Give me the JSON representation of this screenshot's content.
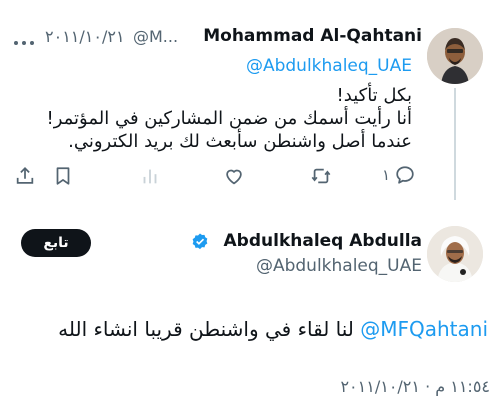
{
  "tweet1": {
    "author_name": "Mohammad Al-Qahtani",
    "handle_trunc": "@M...",
    "date": "٢٠١١/١٠/٢١",
    "reply_to": "@Abdulkhaleq_UAE",
    "lines": [
      "بكل تأكيد!",
      "أنا رأيت أسمك من ضمن المشاركين في المؤتمر!",
      "عندما أصل واشنطن سأبعث لك بريد الكتروني."
    ],
    "reply_count": "١"
  },
  "tweet2": {
    "author_name": "Abdulkhaleq Abdulla",
    "handle": "@Abdulkhaleq_UAE",
    "follow_label": "تابع",
    "mention": "@MFQahtani",
    "text": "لنا لقاء في واشنطن قريبا انشاء الله",
    "timestamp": "١١:٥٤ م · ٢٠١١/١٠/٢١"
  },
  "icons": {
    "more": "more-dots-icon",
    "verified": "verified-badge-icon",
    "reply": "reply-icon",
    "retweet": "retweet-icon",
    "like": "like-icon",
    "views": "views-icon",
    "bookmark": "bookmark-icon",
    "share": "share-icon"
  },
  "colors": {
    "link": "#1d9bf0",
    "muted": "#536471",
    "text": "#0f1419",
    "follow_bg": "#0f1419"
  }
}
